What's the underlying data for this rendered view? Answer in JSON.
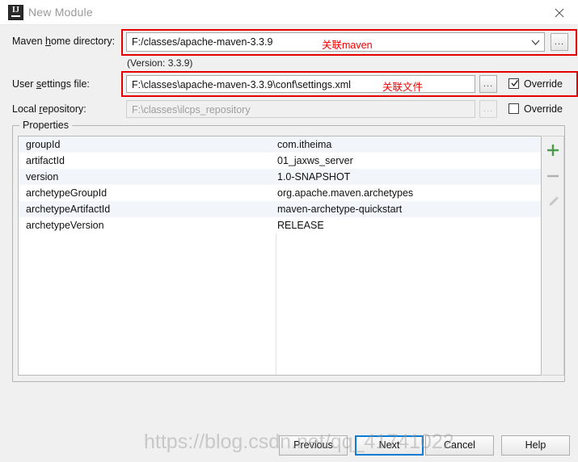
{
  "window": {
    "title": "New Module",
    "logo_text": "IJ",
    "close_label": "✕"
  },
  "form": {
    "maven_home": {
      "label_pre": "Maven ",
      "label_mnemonic": "h",
      "label_post": "ome directory:",
      "label_full": "Maven home directory:",
      "value": "F:/classes/apache-maven-3.3.9",
      "dropdown_icon": "chevron-down-icon",
      "browse_label": "...",
      "annotation": "关联maven",
      "version_note": "(Version: 3.3.9)"
    },
    "user_settings": {
      "label_pre": "User ",
      "label_mnemonic": "s",
      "label_post": "ettings file:",
      "label_full": "User settings file:",
      "value": "F:\\classes\\apache-maven-3.3.9\\conf\\settings.xml",
      "browse_label": "...",
      "override_label": "Override",
      "override_checked": true,
      "annotation": "关联文件"
    },
    "local_repository": {
      "label_pre": "Local ",
      "label_mnemonic": "r",
      "label_post": "epository:",
      "label_full": "Local repository:",
      "value": "F:\\classes\\ilcps_repository",
      "browse_label": "...",
      "override_label": "Override",
      "override_checked": false
    }
  },
  "properties": {
    "legend": "Properties",
    "rows": [
      {
        "key": "groupId",
        "value": "com.itheima"
      },
      {
        "key": "artifactId",
        "value": "01_jaxws_server"
      },
      {
        "key": "version",
        "value": "1.0-SNAPSHOT"
      },
      {
        "key": "archetypeGroupId",
        "value": "org.apache.maven.archetypes"
      },
      {
        "key": "archetypeArtifactId",
        "value": "maven-archetype-quickstart"
      },
      {
        "key": "archetypeVersion",
        "value": "RELEASE"
      }
    ],
    "actions": {
      "add": "add-icon",
      "remove": "remove-icon",
      "edit": "edit-pencil-icon"
    }
  },
  "footer": {
    "previous": "Previous",
    "next": "Next",
    "cancel": "Cancel",
    "help": "Help"
  },
  "watermark": "https://blog.csdn.net/qq_41741022",
  "colors": {
    "annotation_red": "#e60000",
    "default_button_blue": "#0a7bd4",
    "add_green": "#4a9c4a",
    "row_alt": "#f2f6fb",
    "title_text": "#9a9a9a"
  }
}
